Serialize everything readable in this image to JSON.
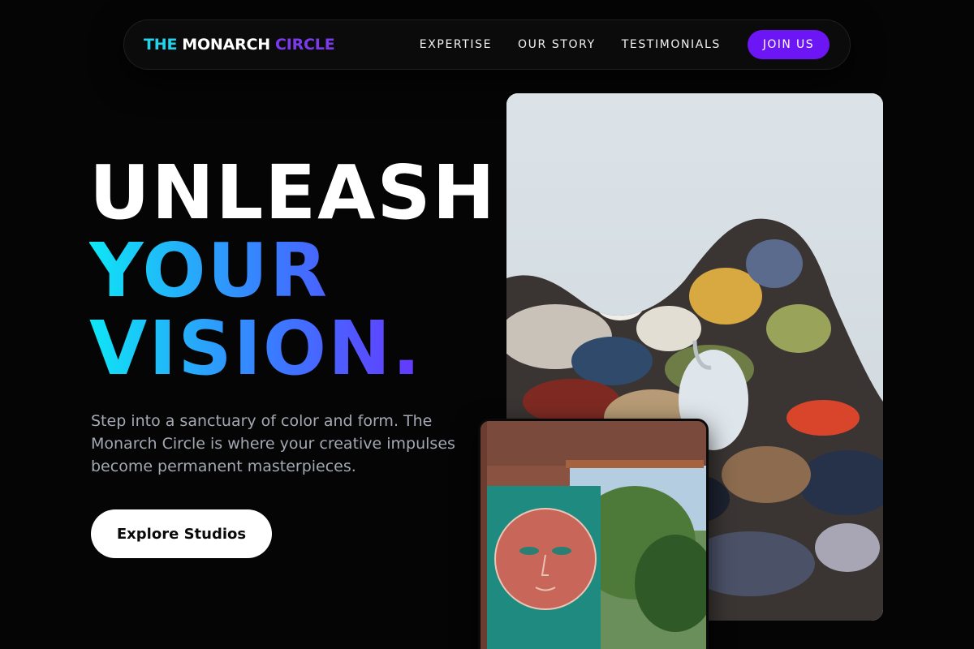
{
  "nav": {
    "logo": {
      "part1": "THE",
      "part2": "MONARCH",
      "part3": "CIRCLE"
    },
    "links": [
      "EXPERTISE",
      "OUR STORY",
      "TESTIMONIALS"
    ],
    "cta_label": "JOIN US"
  },
  "hero": {
    "headline_line1": "UNLEASH",
    "headline_line2": "YOUR",
    "headline_line3": "VISION.",
    "subtext": "Step into a sanctuary of color and form. The Monarch Circle is where your creative impulses become permanent masterpieces.",
    "cta_label": "Explore Studios"
  },
  "colors": {
    "accent_purple": "#6d16f5",
    "accent_cyan": "#22d3ee",
    "background": "#050505"
  }
}
